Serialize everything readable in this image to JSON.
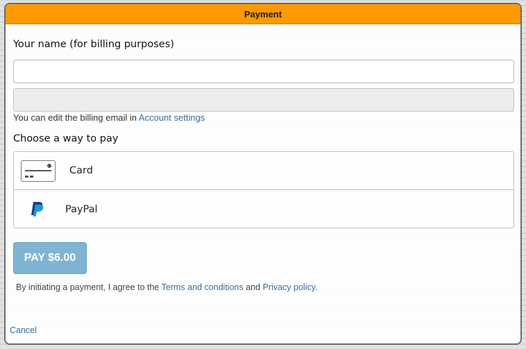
{
  "dialog": {
    "title": "Payment"
  },
  "form": {
    "name_label": "Your name (for billing purposes)",
    "name_value": "",
    "email_value": "",
    "hint_prefix": "You can edit the billing email in ",
    "hint_link": "Account settings",
    "pay_label": "Choose a way to pay"
  },
  "payment_methods": [
    {
      "label": "Card",
      "icon": "credit-card-icon"
    },
    {
      "label": "PayPal",
      "icon": "paypal-icon"
    }
  ],
  "pay_button": {
    "label": "PAY $6.00"
  },
  "agreement": {
    "prefix": "By initiating a payment, I agree to the ",
    "terms": "Terms and conditions",
    "and": " and ",
    "privacy": "Privacy policy",
    "suffix": "."
  },
  "footer": {
    "cancel": "Cancel"
  },
  "colors": {
    "titlebar": "#ff9900",
    "button": "#7fb4d3",
    "link": "#3a6d99"
  }
}
